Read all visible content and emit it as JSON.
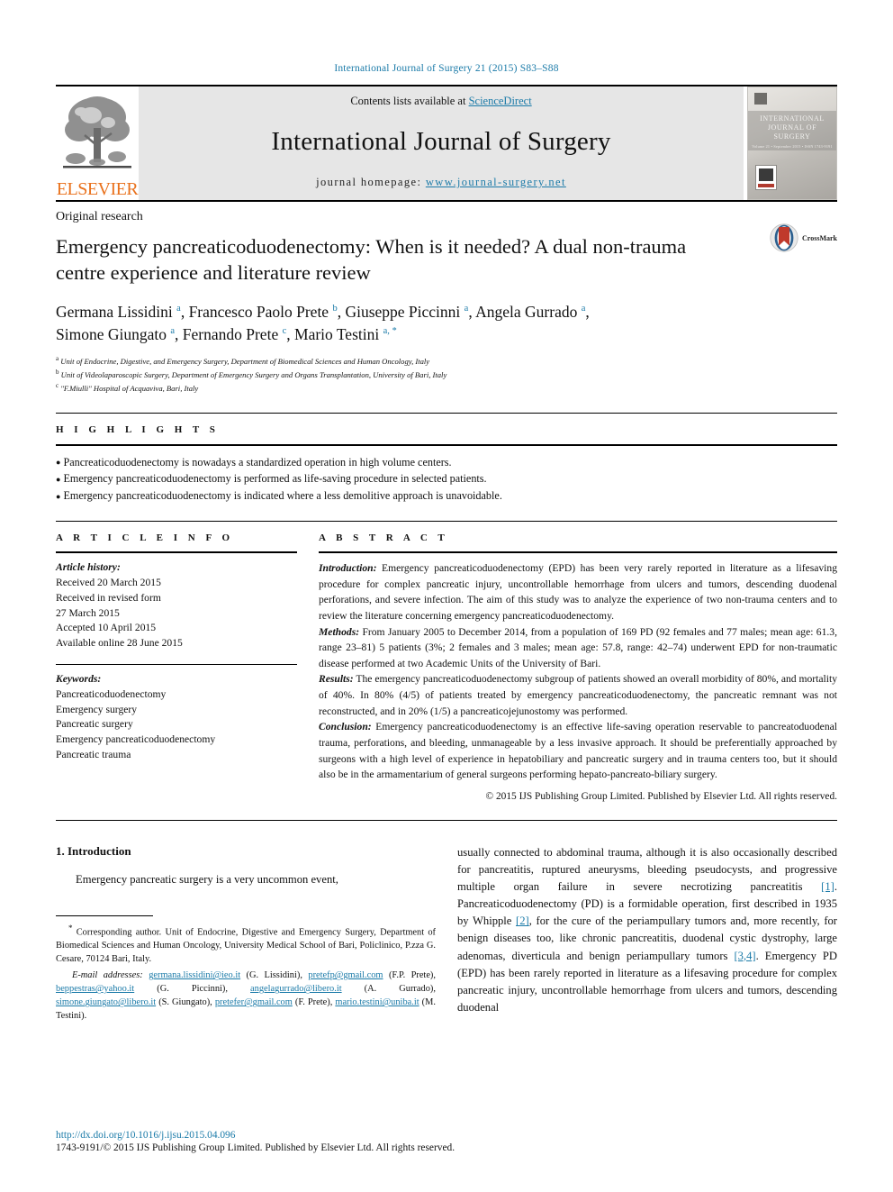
{
  "running_head": "International Journal of Surgery 21 (2015) S83–S88",
  "masthead": {
    "publisher_name": "ELSEVIER",
    "contents_prefix": "Contents lists available at ",
    "contents_link": "ScienceDirect",
    "journal_title": "International Journal of Surgery",
    "homepage_prefix": "journal homepage: ",
    "homepage_url": "www.journal-surgery.net",
    "cover_title": "INTERNATIONAL JOURNAL OF SURGERY",
    "cover_subtitle": "Volume 21 • September 2015 • ISSN 1743-9191"
  },
  "article": {
    "doctype": "Original research",
    "title": "Emergency pancreaticoduodenectomy: When is it needed? A dual non-trauma centre experience and literature review",
    "crossmark_label": "CrossMark",
    "authors_line1_html": "Germana Lissidini <sup class=\"sup\">a</sup>, Francesco Paolo Prete <sup class=\"sup\">b</sup>, Giuseppe Piccinni <sup class=\"sup\">a</sup>, Angela Gurrado <sup class=\"sup\">a</sup>,",
    "authors_line2_html": "Simone Giungato <sup class=\"sup\">a</sup>, Fernando Prete <sup class=\"sup\">c</sup>, Mario Testini <sup class=\"sup\">a, *</sup>",
    "affiliations": [
      {
        "mark": "a",
        "text": "Unit of Endocrine, Digestive, and Emergency Surgery, Department of Biomedical Sciences and Human Oncology, Italy"
      },
      {
        "mark": "b",
        "text": "Unit of Videolaparoscopic Surgery, Department of Emergency Surgery and Organs Transplantation, University of Bari, Italy"
      },
      {
        "mark": "c",
        "text": "\"F.Miulli\" Hospital of Acquaviva, Bari, Italy"
      }
    ]
  },
  "highlights": {
    "heading": "H I G H L I G H T S",
    "items": [
      "Pancreaticoduodenectomy is nowadays a standardized operation in high volume centers.",
      "Emergency pancreaticoduodenectomy is performed as life-saving procedure in selected patients.",
      "Emergency pancreaticoduodenectomy is indicated where a less demolitive approach is unavoidable."
    ]
  },
  "article_info": {
    "heading": "A R T I C L E   I N F O",
    "history_label": "Article history:",
    "history": [
      "Received 20 March 2015",
      "Received in revised form",
      "27 March 2015",
      "Accepted 10 April 2015",
      "Available online 28 June 2015"
    ],
    "keywords_label": "Keywords:",
    "keywords": [
      "Pancreaticoduodenectomy",
      "Emergency surgery",
      "Pancreatic surgery",
      "Emergency pancreaticoduodenectomy",
      "Pancreatic trauma"
    ]
  },
  "abstract": {
    "heading": "A B S T R A C T",
    "sections": [
      {
        "label": "Introduction:",
        "text": " Emergency pancreaticoduodenectomy (EPD) has been very rarely reported in literature as a lifesaving procedure for complex pancreatic injury, uncontrollable hemorrhage from ulcers and tumors, descending duodenal perforations, and severe infection. The aim of this study was to analyze the experience of two non-trauma centers and to review the literature concerning emergency pancreaticoduodenectomy."
      },
      {
        "label": "Methods:",
        "text": " From January 2005 to December 2014, from a population of 169 PD (92 females and 77 males; mean age: 61.3, range 23–81) 5 patients (3%; 2 females and 3 males; mean age: 57.8, range: 42–74) underwent EPD for non-traumatic disease performed at two Academic Units of the University of Bari."
      },
      {
        "label": "Results:",
        "text": " The emergency pancreaticoduodenectomy subgroup of patients showed an overall morbidity of 80%, and mortality of 40%. In 80% (4/5) of patients treated by emergency pancreaticoduodenectomy, the pancreatic remnant was not reconstructed, and in 20% (1/5) a pancreaticojejunostomy was performed."
      },
      {
        "label": "Conclusion:",
        "text": " Emergency pancreaticoduodenectomy is an effective life-saving operation reservable to pancreatoduodenal trauma, perforations, and bleeding, unmanageable by a less invasive approach. It should be preferentially approached by surgeons with a high level of experience in hepatobiliary and pancreatic surgery and in trauma centers too, but it should also be in the armamentarium of general surgeons performing hepato-pancreato-biliary surgery."
      }
    ],
    "copyright": "© 2015 IJS Publishing Group Limited. Published by Elsevier Ltd. All rights reserved."
  },
  "body": {
    "left": {
      "section_number_title": "1.  Introduction",
      "paragraph": "Emergency pancreatic surgery is a very uncommon event,"
    },
    "right": {
      "paragraph_1": "usually connected to abdominal trauma, although it is also occasionally described for pancreatitis, ruptured aneurysms, bleeding pseudocysts, and progressive multiple organ failure in severe necrotizing pancreatitis",
      "ref_1": "[1]",
      "paragraph_2": ". Pancreaticoduodenectomy (PD) is a formidable operation, first described in 1935 by Whipple",
      "ref_2": "[2]",
      "paragraph_3": ", for the cure of the periampullary tumors and, more recently, for benign diseases too, like chronic pancreatitis, duodenal cystic dystrophy, large adenomas, diverticula and benign periampullary tumors",
      "ref_3": "[3,4]",
      "paragraph_4": ". Emergency PD (EPD) has been rarely reported in literature as a lifesaving procedure for complex pancreatic injury, uncontrollable hemorrhage from ulcers and tumors, descending duodenal"
    }
  },
  "footnote": {
    "corresponding_star": "*",
    "corresponding_text": " Corresponding author. Unit of Endocrine, Digestive and Emergency Surgery, Department of Biomedical Sciences and Human Oncology, University Medical School of Bari, Policlinico, P.zza G. Cesare, 70124 Bari, Italy.",
    "email_label": "E-mail addresses:",
    "emails": [
      {
        "address": "germana.lissidini@ieo.it",
        "person": "(G. Lissidini),"
      },
      {
        "address": "pretefp@gmail.com",
        "person": "(F.P. Prete),"
      },
      {
        "address": "beppestras@yahoo.it",
        "person": "(G. Piccinni),"
      },
      {
        "address": "angelagurrado@libero.it",
        "person": "(A. Gurrado),"
      },
      {
        "address": "simone.giungato@libero.it",
        "person": "(S. Giungato),"
      },
      {
        "address": "pretefer@gmail.com",
        "person": "(F. Prete),"
      },
      {
        "address": "mario.testini@uniba.it",
        "person": "(M. Testini)."
      }
    ]
  },
  "page_footer": {
    "doi": "http://dx.doi.org/10.1016/j.ijsu.2015.04.096",
    "issn_line": "1743-9191/© 2015 IJS Publishing Group Limited. Published by Elsevier Ltd. All rights reserved."
  },
  "colors": {
    "link": "#1a7aa8",
    "elsevier_orange": "#E9711C",
    "band_gray": "#e6e6e6"
  }
}
